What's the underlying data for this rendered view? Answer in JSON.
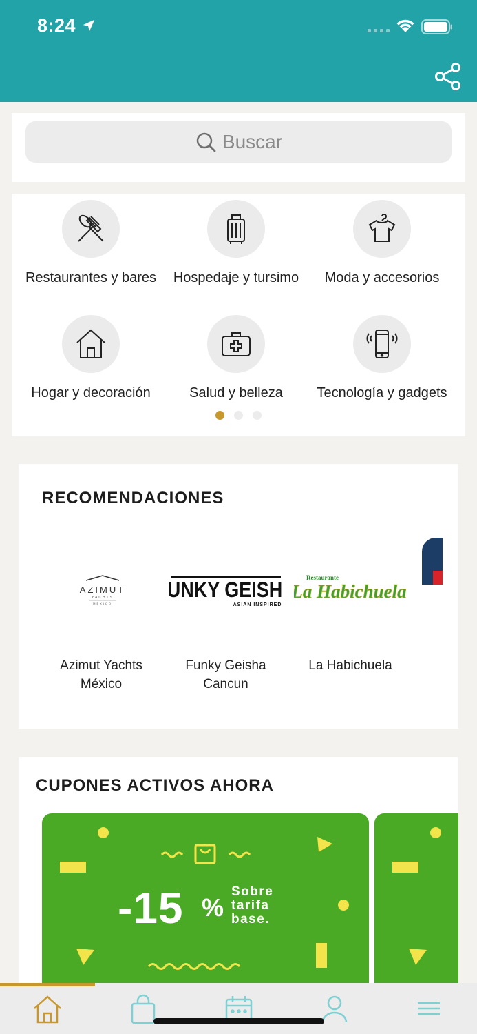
{
  "status_bar": {
    "time": "8:24"
  },
  "search": {
    "placeholder": "Buscar"
  },
  "categories": [
    {
      "label": "Restaurantes y bares",
      "icon": "fork-spoon-icon"
    },
    {
      "label": "Hospedaje y tursimo",
      "icon": "suitcase-icon"
    },
    {
      "label": "Moda y accesorios",
      "icon": "shirt-icon"
    },
    {
      "label": "Hogar y decoración",
      "icon": "house-icon"
    },
    {
      "label": "Salud y belleza",
      "icon": "first-aid-icon"
    },
    {
      "label": "Tecnología y gadgets",
      "icon": "phone-icon"
    }
  ],
  "category_pages": {
    "count": 3,
    "active": 1
  },
  "recomendaciones": {
    "title": "RECOMENDACIONES",
    "items": [
      {
        "name": "Azimut Yachts México",
        "logo_text": "AZIMUT",
        "logo_sub": "YACHTS",
        "logo_sub2": "MÉXICO"
      },
      {
        "name": "Funky Geisha Cancun",
        "logo_text": "FUNKY GEISHA",
        "logo_sub": "ASIAN INSPIRED"
      },
      {
        "name": "La Habichuela",
        "logo_text": "La Habichuela",
        "logo_sub": "Restaurante"
      }
    ]
  },
  "cupones": {
    "title": "CUPONES ACTIVOS AHORA",
    "coupon": {
      "value": "-15",
      "percent": "%",
      "line1": "Sobre",
      "line2": "tarifa",
      "line3": "base."
    }
  },
  "colors": {
    "header": "#21a3a8",
    "accent": "#c9982c",
    "coupon": "#4aaa26",
    "coupon_shapes": "#f2e44a"
  },
  "bottom_nav": [
    {
      "icon": "home-icon",
      "active": true
    },
    {
      "icon": "shopping-bag-icon",
      "active": false
    },
    {
      "icon": "calendar-icon",
      "active": false
    },
    {
      "icon": "user-icon",
      "active": false
    },
    {
      "icon": "menu-icon",
      "active": false
    }
  ]
}
